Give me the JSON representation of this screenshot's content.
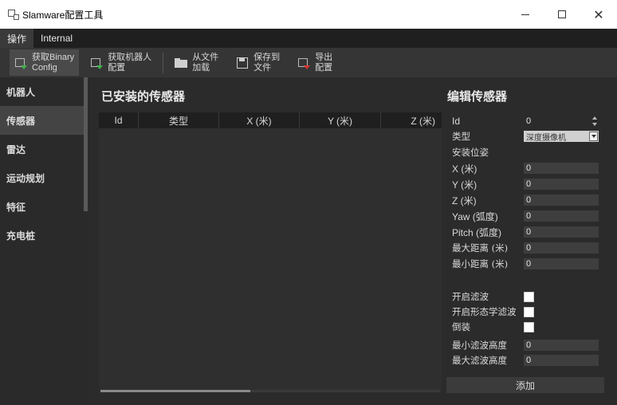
{
  "window": {
    "title": "Slamware配置工具"
  },
  "menu": {
    "items": [
      "操作",
      "Internal"
    ]
  },
  "toolbar": {
    "fetch_binary_line1": "获取Binary",
    "fetch_binary_line2": "Config",
    "fetch_robot_line1": "获取机器人",
    "fetch_robot_line2": "配置",
    "load_file_line1": "从文件",
    "load_file_line2": "加载",
    "save_file_line1": "保存到",
    "save_file_line2": "文件",
    "export_line1": "导出",
    "export_line2": "配置"
  },
  "sidebar": {
    "items": [
      "机器人",
      "传感器",
      "雷达",
      "运动规划",
      "特征",
      "充电桩"
    ],
    "active_index": 1
  },
  "installed": {
    "title": "已安装的传感器",
    "columns": [
      "Id",
      "类型",
      "X (米)",
      "Y (米)",
      "Z (米)"
    ],
    "rows": []
  },
  "editor": {
    "title": "编辑传感器",
    "id_label": "Id",
    "id_value": "0",
    "type_label": "类型",
    "type_value": "深度摄像机",
    "pose_label": "安装位姿",
    "x_label": "X (米)",
    "x_value": "0",
    "y_label": "Y (米)",
    "y_value": "0",
    "z_label": "Z (米)",
    "z_value": "0",
    "yaw_label": "Yaw (弧度)",
    "yaw_value": "0",
    "pitch_label": "Pitch (弧度)",
    "pitch_value": "0",
    "max_dist_label": "最大距离 (米)",
    "max_dist_value": "0",
    "min_dist_label": "最小距离 (米)",
    "min_dist_value": "0",
    "filter_label": "开启滤波",
    "morph_filter_label": "开启形态学滤波",
    "inverted_label": "倒装",
    "min_filter_h_label": "最小滤波高度",
    "min_filter_h_value": "0",
    "max_filter_h_label": "最大滤波高度",
    "max_filter_h_value": "0",
    "add_label": "添加"
  },
  "colors": {
    "background": "#2b2b2b",
    "toolbar": "#353535",
    "sidebar_active": "#444444",
    "fetch_arrow": "#3cb34a",
    "export_arrow": "#dd3333"
  }
}
